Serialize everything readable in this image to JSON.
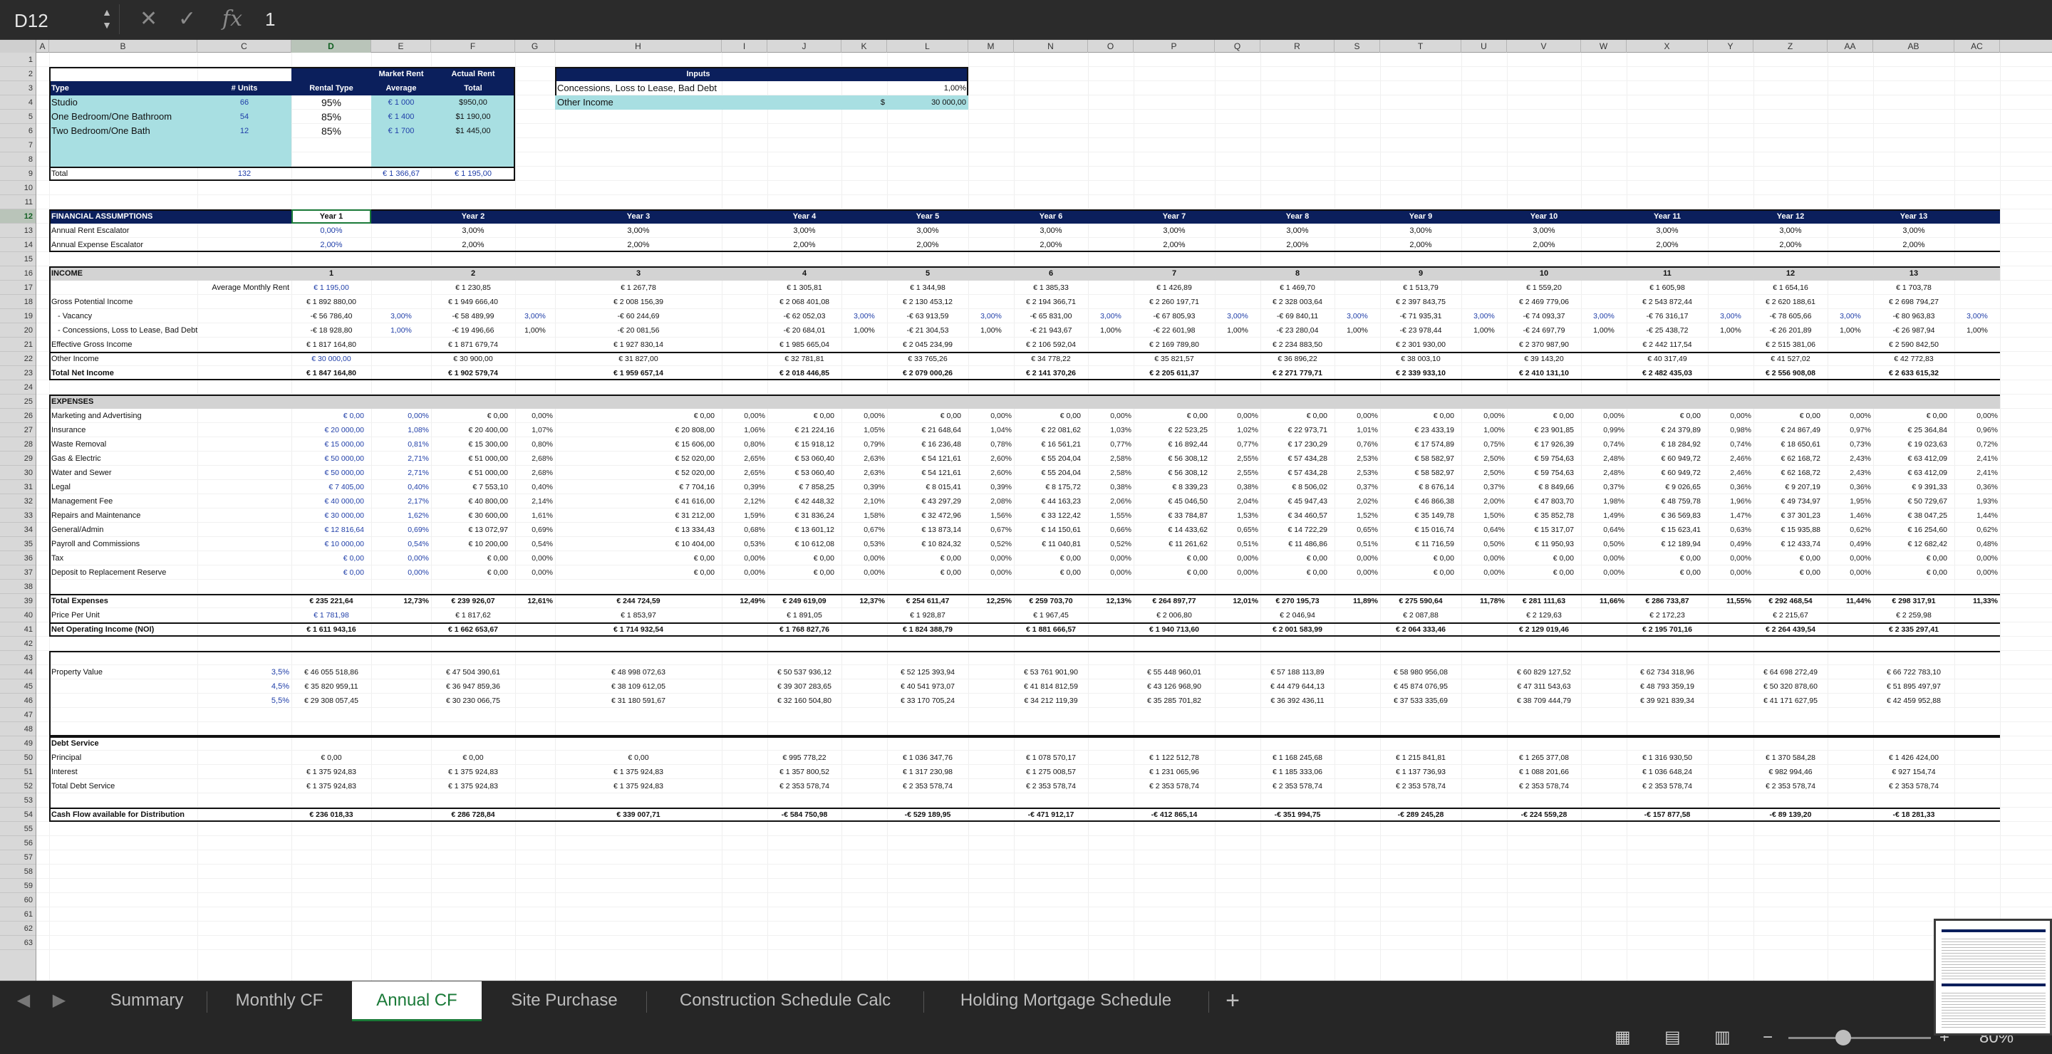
{
  "formula_bar": {
    "cell_ref": "D12",
    "formula": "1"
  },
  "column_headers": [
    "A",
    "B",
    "C",
    "D",
    "E",
    "F",
    "G",
    "H",
    "I",
    "J",
    "K",
    "L",
    "M",
    "N",
    "O",
    "P",
    "Q",
    "R",
    "S",
    "T",
    "U",
    "V",
    "W",
    "X",
    "Y",
    "Z",
    "AA",
    "AB",
    "AC"
  ],
  "row_numbers": [
    "1",
    "2",
    "3",
    "4",
    "5",
    "6",
    "7",
    "8",
    "9",
    "10",
    "11",
    "12",
    "13",
    "14",
    "15",
    "16",
    "17",
    "18",
    "19",
    "20",
    "21",
    "22",
    "23",
    "24",
    "25",
    "26",
    "27",
    "28",
    "29",
    "30",
    "31",
    "32",
    "33",
    "34",
    "35",
    "36",
    "37",
    "38",
    "39",
    "40",
    "41",
    "42",
    "43",
    "44",
    "45",
    "46",
    "47",
    "48",
    "49",
    "50",
    "51",
    "52",
    "53",
    "54",
    "55",
    "56",
    "57",
    "58",
    "59",
    "60",
    "61",
    "62",
    "63"
  ],
  "unit_mix": {
    "hdr_market_rent": "Market Rent",
    "hdr_actual_rent": "Actual Rent",
    "hdr_type": "Type",
    "hdr_units": "# Units",
    "hdr_rental_type": "Rental Type",
    "hdr_average": "Average",
    "hdr_total": "Total",
    "rows": [
      {
        "type": "Studio",
        "units": "66",
        "rental": "95%",
        "avg": "€ 1 000",
        "total": "$950,00"
      },
      {
        "type": "One Bedroom/One Bathroom",
        "units": "54",
        "rental": "85%",
        "avg": "€ 1 400",
        "total": "$1 190,00"
      },
      {
        "type": "Two Bedroom/One Bath",
        "units": "12",
        "rental": "85%",
        "avg": "€ 1 700",
        "total": "$1 445,00"
      }
    ],
    "total_label": "Total",
    "total_units": "132",
    "total_avg": "€ 1 366,67",
    "total_total": "€ 1 195,00"
  },
  "inputs": {
    "title": "Inputs",
    "row1_label": "Concessions, Loss to Lease, Bad Debt",
    "row1_value": "1,00%",
    "row2_label": "Other Income",
    "row2_cur": "$",
    "row2_value": "30 000,00"
  },
  "fin": {
    "title": "FINANCIAL ASSUMPTIONS",
    "years": [
      "Year 1",
      "Year 2",
      "Year 3",
      "Year 4",
      "Year 5",
      "Year 6",
      "Year 7",
      "Year 8",
      "Year 9",
      "Year 10",
      "Year 11",
      "Year 12",
      "Year 13"
    ],
    "rent_label": "Annual Rent Escalator",
    "rent": [
      "0,00%",
      "3,00%",
      "3,00%",
      "3,00%",
      "3,00%",
      "3,00%",
      "3,00%",
      "3,00%",
      "3,00%",
      "3,00%",
      "3,00%",
      "3,00%",
      "3,00%"
    ],
    "exp_label": "Annual Expense Escalator",
    "exp": [
      "2,00%",
      "2,00%",
      "2,00%",
      "2,00%",
      "2,00%",
      "2,00%",
      "2,00%",
      "2,00%",
      "2,00%",
      "2,00%",
      "2,00%",
      "2,00%",
      "2,00%"
    ]
  },
  "income": {
    "title": "INCOME",
    "year_nums": [
      "1",
      "2",
      "3",
      "4",
      "5",
      "6",
      "7",
      "8",
      "9",
      "10",
      "11",
      "12",
      "13"
    ],
    "avg_rent_label": "Average Monthly Rent",
    "avg_rent": [
      "€ 1 195,00",
      "€ 1 230,85",
      "€ 1 267,78",
      "€ 1 305,81",
      "€ 1 344,98",
      "€ 1 385,33",
      "€ 1 426,89",
      "€ 1 469,70",
      "€ 1 513,79",
      "€ 1 559,20",
      "€ 1 605,98",
      "€ 1 654,16",
      "€ 1 703,78"
    ],
    "gpi_label": "Gross Potential Income",
    "gpi": [
      "€ 1 892 880,00",
      "€ 1 949 666,40",
      "€ 2 008 156,39",
      "€ 2 068 401,08",
      "€ 2 130 453,12",
      "€ 2 194 366,71",
      "€ 2 260 197,71",
      "€ 2 328 003,64",
      "€ 2 397 843,75",
      "€ 2 469 779,06",
      "€ 2 543 872,44",
      "€ 2 620 188,61",
      "€ 2 698 794,27"
    ],
    "vac_label": "- Vacancy",
    "vac": [
      "-€ 56 786,40",
      "-€ 58 489,99",
      "-€ 60 244,69",
      "-€ 62 052,03",
      "-€ 63 913,59",
      "-€ 65 831,00",
      "-€ 67 805,93",
      "-€ 69 840,11",
      "-€ 71 935,31",
      "-€ 74 093,37",
      "-€ 76 316,17",
      "-€ 78 605,66",
      "-€ 80 963,83"
    ],
    "vac_pct": [
      "3,00%",
      "3,00%",
      "",
      "3,00%",
      "3,00%",
      "3,00%",
      "3,00%",
      "3,00%",
      "3,00%",
      "3,00%",
      "3,00%",
      "3,00%",
      "3,00%"
    ],
    "con_label": "- Concessions, Loss to Lease, Bad Debt",
    "con": [
      "-€ 18 928,80",
      "-€ 19 496,66",
      "-€ 20 081,56",
      "-€ 20 684,01",
      "-€ 21 304,53",
      "-€ 21 943,67",
      "-€ 22 601,98",
      "-€ 23 280,04",
      "-€ 23 978,44",
      "-€ 24 697,79",
      "-€ 25 438,72",
      "-€ 26 201,89",
      "-€ 26 987,94"
    ],
    "con_pct": [
      "1,00%",
      "1,00%",
      "",
      "1,00%",
      "1,00%",
      "1,00%",
      "1,00%",
      "1,00%",
      "1,00%",
      "1,00%",
      "1,00%",
      "1,00%",
      "1,00%"
    ],
    "egi_label": "Effective Gross Income",
    "egi": [
      "€ 1 817 164,80",
      "€ 1 871 679,74",
      "€ 1 927 830,14",
      "€ 1 985 665,04",
      "€ 2 045 234,99",
      "€ 2 106 592,04",
      "€ 2 169 789,80",
      "€ 2 234 883,50",
      "€ 2 301 930,00",
      "€ 2 370 987,90",
      "€ 2 442 117,54",
      "€ 2 515 381,06",
      "€ 2 590 842,50"
    ],
    "oi_label": "Other Income",
    "oi": [
      "€ 30 000,00",
      "€ 30 900,00",
      "€ 31 827,00",
      "€ 32 781,81",
      "€ 33 765,26",
      "€ 34 778,22",
      "€ 35 821,57",
      "€ 36 896,22",
      "€ 38 003,10",
      "€ 39 143,20",
      "€ 40 317,49",
      "€ 41 527,02",
      "€ 42 772,83"
    ],
    "tni_label": "Total Net Income",
    "tni": [
      "€ 1 847 164,80",
      "€ 1 902 579,74",
      "€ 1 959 657,14",
      "€ 2 018 446,85",
      "€ 2 079 000,26",
      "€ 2 141 370,26",
      "€ 2 205 611,37",
      "€ 2 271 779,71",
      "€ 2 339 933,10",
      "€ 2 410 131,10",
      "€ 2 482 435,03",
      "€ 2 556 908,08",
      "€ 2 633 615,32"
    ]
  },
  "expenses": {
    "title": "EXPENSES",
    "rows": [
      {
        "label": "Marketing and Advertising",
        "v": [
          "€ 0,00",
          "€ 0,00",
          "€ 0,00",
          "€ 0,00",
          "€ 0,00",
          "€ 0,00",
          "€ 0,00",
          "€ 0,00",
          "€ 0,00",
          "€ 0,00",
          "€ 0,00",
          "€ 0,00",
          "€ 0,00"
        ],
        "p": [
          "0,00%",
          "0,00%",
          "0,00%",
          "0,00%",
          "0,00%",
          "0,00%",
          "0,00%",
          "0,00%",
          "0,00%",
          "0,00%",
          "0,00%",
          "0,00%",
          "0,00%"
        ]
      },
      {
        "label": "Insurance",
        "v": [
          "€ 20 000,00",
          "€ 20 400,00",
          "€ 20 808,00",
          "€ 21 224,16",
          "€ 21 648,64",
          "€ 22 081,62",
          "€ 22 523,25",
          "€ 22 973,71",
          "€ 23 433,19",
          "€ 23 901,85",
          "€ 24 379,89",
          "€ 24 867,49",
          "€ 25 364,84"
        ],
        "p": [
          "1,08%",
          "1,07%",
          "1,06%",
          "1,05%",
          "1,04%",
          "1,03%",
          "1,02%",
          "1,01%",
          "1,00%",
          "0,99%",
          "0,98%",
          "0,97%",
          "0,96%"
        ]
      },
      {
        "label": "Waste Removal",
        "v": [
          "€ 15 000,00",
          "€ 15 300,00",
          "€ 15 606,00",
          "€ 15 918,12",
          "€ 16 236,48",
          "€ 16 561,21",
          "€ 16 892,44",
          "€ 17 230,29",
          "€ 17 574,89",
          "€ 17 926,39",
          "€ 18 284,92",
          "€ 18 650,61",
          "€ 19 023,63"
        ],
        "p": [
          "0,81%",
          "0,80%",
          "0,80%",
          "0,79%",
          "0,78%",
          "0,77%",
          "0,77%",
          "0,76%",
          "0,75%",
          "0,74%",
          "0,74%",
          "0,73%",
          "0,72%"
        ]
      },
      {
        "label": "Gas & Electric",
        "v": [
          "€ 50 000,00",
          "€ 51 000,00",
          "€ 52 020,00",
          "€ 53 060,40",
          "€ 54 121,61",
          "€ 55 204,04",
          "€ 56 308,12",
          "€ 57 434,28",
          "€ 58 582,97",
          "€ 59 754,63",
          "€ 60 949,72",
          "€ 62 168,72",
          "€ 63 412,09"
        ],
        "p": [
          "2,71%",
          "2,68%",
          "2,65%",
          "2,63%",
          "2,60%",
          "2,58%",
          "2,55%",
          "2,53%",
          "2,50%",
          "2,48%",
          "2,46%",
          "2,43%",
          "2,41%"
        ]
      },
      {
        "label": "Water and Sewer",
        "v": [
          "€ 50 000,00",
          "€ 51 000,00",
          "€ 52 020,00",
          "€ 53 060,40",
          "€ 54 121,61",
          "€ 55 204,04",
          "€ 56 308,12",
          "€ 57 434,28",
          "€ 58 582,97",
          "€ 59 754,63",
          "€ 60 949,72",
          "€ 62 168,72",
          "€ 63 412,09"
        ],
        "p": [
          "2,71%",
          "2,68%",
          "2,65%",
          "2,63%",
          "2,60%",
          "2,58%",
          "2,55%",
          "2,53%",
          "2,50%",
          "2,48%",
          "2,46%",
          "2,43%",
          "2,41%"
        ]
      },
      {
        "label": "Legal",
        "v": [
          "€ 7 405,00",
          "€ 7 553,10",
          "€ 7 704,16",
          "€ 7 858,25",
          "€ 8 015,41",
          "€ 8 175,72",
          "€ 8 339,23",
          "€ 8 506,02",
          "€ 8 676,14",
          "€ 8 849,66",
          "€ 9 026,65",
          "€ 9 207,19",
          "€ 9 391,33"
        ],
        "p": [
          "0,40%",
          "0,40%",
          "0,39%",
          "0,39%",
          "0,39%",
          "0,38%",
          "0,38%",
          "0,37%",
          "0,37%",
          "0,37%",
          "0,36%",
          "0,36%",
          "0,36%"
        ]
      },
      {
        "label": "Management Fee",
        "v": [
          "€ 40 000,00",
          "€ 40 800,00",
          "€ 41 616,00",
          "€ 42 448,32",
          "€ 43 297,29",
          "€ 44 163,23",
          "€ 45 046,50",
          "€ 45 947,43",
          "€ 46 866,38",
          "€ 47 803,70",
          "€ 48 759,78",
          "€ 49 734,97",
          "€ 50 729,67"
        ],
        "p": [
          "2,17%",
          "2,14%",
          "2,12%",
          "2,10%",
          "2,08%",
          "2,06%",
          "2,04%",
          "2,02%",
          "2,00%",
          "1,98%",
          "1,96%",
          "1,95%",
          "1,93%"
        ]
      },
      {
        "label": "Repairs and Maintenance",
        "v": [
          "€ 30 000,00",
          "€ 30 600,00",
          "€ 31 212,00",
          "€ 31 836,24",
          "€ 32 472,96",
          "€ 33 122,42",
          "€ 33 784,87",
          "€ 34 460,57",
          "€ 35 149,78",
          "€ 35 852,78",
          "€ 36 569,83",
          "€ 37 301,23",
          "€ 38 047,25"
        ],
        "p": [
          "1,62%",
          "1,61%",
          "1,59%",
          "1,58%",
          "1,56%",
          "1,55%",
          "1,53%",
          "1,52%",
          "1,50%",
          "1,49%",
          "1,47%",
          "1,46%",
          "1,44%"
        ]
      },
      {
        "label": "General/Admin",
        "v": [
          "€ 12 816,64",
          "€ 13 072,97",
          "€ 13 334,43",
          "€ 13 601,12",
          "€ 13 873,14",
          "€ 14 150,61",
          "€ 14 433,62",
          "€ 14 722,29",
          "€ 15 016,74",
          "€ 15 317,07",
          "€ 15 623,41",
          "€ 15 935,88",
          "€ 16 254,60"
        ],
        "p": [
          "0,69%",
          "0,69%",
          "0,68%",
          "0,67%",
          "0,67%",
          "0,66%",
          "0,65%",
          "0,65%",
          "0,64%",
          "0,64%",
          "0,63%",
          "0,62%",
          "0,62%"
        ]
      },
      {
        "label": "Payroll and Commissions",
        "v": [
          "€ 10 000,00",
          "€ 10 200,00",
          "€ 10 404,00",
          "€ 10 612,08",
          "€ 10 824,32",
          "€ 11 040,81",
          "€ 11 261,62",
          "€ 11 486,86",
          "€ 11 716,59",
          "€ 11 950,93",
          "€ 12 189,94",
          "€ 12 433,74",
          "€ 12 682,42"
        ],
        "p": [
          "0,54%",
          "0,54%",
          "0,53%",
          "0,53%",
          "0,52%",
          "0,52%",
          "0,51%",
          "0,51%",
          "0,50%",
          "0,50%",
          "0,49%",
          "0,49%",
          "0,48%"
        ]
      },
      {
        "label": "Tax",
        "v": [
          "€ 0,00",
          "€ 0,00",
          "€ 0,00",
          "€ 0,00",
          "€ 0,00",
          "€ 0,00",
          "€ 0,00",
          "€ 0,00",
          "€ 0,00",
          "€ 0,00",
          "€ 0,00",
          "€ 0,00",
          "€ 0,00"
        ],
        "p": [
          "0,00%",
          "0,00%",
          "0,00%",
          "0,00%",
          "0,00%",
          "0,00%",
          "0,00%",
          "0,00%",
          "0,00%",
          "0,00%",
          "0,00%",
          "0,00%",
          "0,00%"
        ]
      },
      {
        "label": "Deposit to Replacement Reserve",
        "v": [
          "€ 0,00",
          "€ 0,00",
          "€ 0,00",
          "€ 0,00",
          "€ 0,00",
          "€ 0,00",
          "€ 0,00",
          "€ 0,00",
          "€ 0,00",
          "€ 0,00",
          "€ 0,00",
          "€ 0,00",
          "€ 0,00"
        ],
        "p": [
          "0,00%",
          "0,00%",
          "0,00%",
          "0,00%",
          "0,00%",
          "0,00%",
          "0,00%",
          "0,00%",
          "0,00%",
          "0,00%",
          "0,00%",
          "0,00%",
          "0,00%"
        ]
      }
    ],
    "total_label": "Total Expenses",
    "total": [
      "€ 235 221,64",
      "€ 239 926,07",
      "€ 244 724,59",
      "€ 249 619,09",
      "€ 254 611,47",
      "€ 259 703,70",
      "€ 264 897,77",
      "€ 270 195,73",
      "€ 275 590,64",
      "€ 281 111,63",
      "€ 286 733,87",
      "€ 292 468,54",
      "€ 298 317,91"
    ],
    "total_pct": [
      "12,73%",
      "12,61%",
      "12,49%",
      "12,37%",
      "12,25%",
      "12,13%",
      "12,01%",
      "11,89%",
      "11,78%",
      "11,66%",
      "11,55%",
      "11,44%",
      "11,33%"
    ],
    "ppu_label": "Price Per Unit",
    "ppu": [
      "€ 1 781,98",
      "€ 1 817,62",
      "€ 1 853,97",
      "€ 1 891,05",
      "€ 1 928,87",
      "€ 1 967,45",
      "€ 2 006,80",
      "€ 2 046,94",
      "€ 2 087,88",
      "€ 2 129,63",
      "€ 2 172,23",
      "€ 2 215,67",
      "€ 2 259,98"
    ],
    "noi_label": "Net Operating Income (NOI)",
    "noi": [
      "€ 1 611 943,16",
      "€ 1 662 653,67",
      "€ 1 714 932,54",
      "€ 1 768 827,76",
      "€ 1 824 388,79",
      "€ 1 881 666,57",
      "€ 1 940 713,60",
      "€ 2 001 583,99",
      "€ 2 064 333,46",
      "€ 2 129 019,46",
      "€ 2 195 701,16",
      "€ 2 264 439,54",
      "€ 2 335 297,41"
    ]
  },
  "property": {
    "label": "Property Value",
    "caps": [
      "3,5%",
      "4,5%",
      "5,5%"
    ],
    "values": [
      [
        "€ 46 055 518,86",
        "€ 47 504 390,61",
        "€ 48 998 072,63",
        "€ 50 537 936,12",
        "€ 52 125 393,94",
        "€ 53 761 901,90",
        "€ 55 448 960,01",
        "€ 57 188 113,89",
        "€ 58 980 956,08",
        "€ 60 829 127,52",
        "€ 62 734 318,96",
        "€ 64 698 272,49",
        "€ 66 722 783,10"
      ],
      [
        "€ 35 820 959,11",
        "€ 36 947 859,36",
        "€ 38 109 612,05",
        "€ 39 307 283,65",
        "€ 40 541 973,07",
        "€ 41 814 812,59",
        "€ 43 126 968,90",
        "€ 44 479 644,13",
        "€ 45 874 076,95",
        "€ 47 311 543,63",
        "€ 48 793 359,19",
        "€ 50 320 878,60",
        "€ 51 895 497,97"
      ],
      [
        "€ 29 308 057,45",
        "€ 30 230 066,75",
        "€ 31 180 591,67",
        "€ 32 160 504,80",
        "€ 33 170 705,24",
        "€ 34 212 119,39",
        "€ 35 285 701,82",
        "€ 36 392 436,11",
        "€ 37 533 335,69",
        "€ 38 709 444,79",
        "€ 39 921 839,34",
        "€ 41 171 627,95",
        "€ 42 459 952,88"
      ]
    ]
  },
  "debt": {
    "title": "Debt Service",
    "principal_label": "Principal",
    "principal": [
      "€ 0,00",
      "€ 0,00",
      "€ 0,00",
      "€ 995 778,22",
      "€ 1 036 347,76",
      "€ 1 078 570,17",
      "€ 1 122 512,78",
      "€ 1 168 245,68",
      "€ 1 215 841,81",
      "€ 1 265 377,08",
      "€ 1 316 930,50",
      "€ 1 370 584,28",
      "€ 1 426 424,00"
    ],
    "interest_label": "Interest",
    "interest": [
      "€ 1 375 924,83",
      "€ 1 375 924,83",
      "€ 1 375 924,83",
      "€ 1 357 800,52",
      "€ 1 317 230,98",
      "€ 1 275 008,57",
      "€ 1 231 065,96",
      "€ 1 185 333,06",
      "€ 1 137 736,93",
      "€ 1 088 201,66",
      "€ 1 036 648,24",
      "€ 982 994,46",
      "€ 927 154,74"
    ],
    "total_label": "Total Debt Service",
    "total": [
      "€ 1 375 924,83",
      "€ 1 375 924,83",
      "€ 1 375 924,83",
      "€ 2 353 578,74",
      "€ 2 353 578,74",
      "€ 2 353 578,74",
      "€ 2 353 578,74",
      "€ 2 353 578,74",
      "€ 2 353 578,74",
      "€ 2 353 578,74",
      "€ 2 353 578,74",
      "€ 2 353 578,74",
      "€ 2 353 578,74"
    ],
    "cf_label": "Cash Flow available for Distribution",
    "cf": [
      "€ 236 018,33",
      "€ 286 728,84",
      "€ 339 007,71",
      "-€ 584 750,98",
      "-€ 529 189,95",
      "-€ 471 912,17",
      "-€ 412 865,14",
      "-€ 351 994,75",
      "-€ 289 245,28",
      "-€ 224 559,28",
      "-€ 157 877,58",
      "-€ 89 139,20",
      "-€ 18 281,33"
    ]
  },
  "tabs": [
    "Summary",
    "Monthly CF",
    "Annual CF",
    "Site Purchase",
    "Construction Schedule Calc",
    "Holding Mortgage Schedule"
  ],
  "active_tab": "Annual CF",
  "add_sheet": "+",
  "zoom": "80%",
  "colors": {
    "navy": "#0b1f5c",
    "cyan": "#a8dfe2",
    "blue_input": "#1f3ea8",
    "accent": "#1a7a38"
  }
}
